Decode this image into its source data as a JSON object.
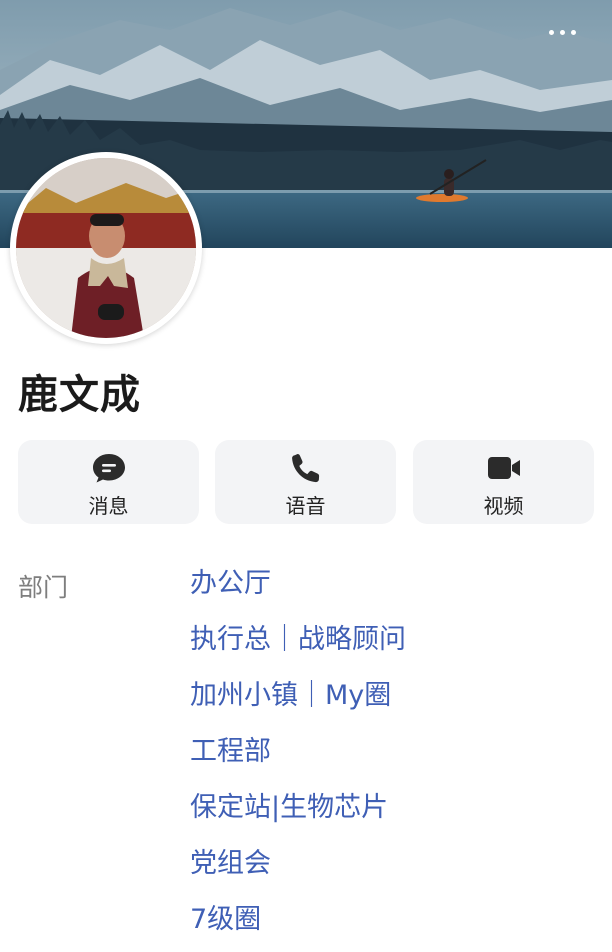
{
  "profile": {
    "name": "鹿文成"
  },
  "actions": [
    {
      "label": "消息",
      "icon": "message-icon"
    },
    {
      "label": "语音",
      "icon": "phone-icon"
    },
    {
      "label": "视频",
      "icon": "video-icon"
    }
  ],
  "department": {
    "label": "部门",
    "items": [
      "办公厅",
      "执行总｜战略顾问",
      "加州小镇｜My圈",
      "工程部",
      "保定站|生物芯片",
      "党组会",
      "7级圈"
    ]
  },
  "colors": {
    "link": "#3f5fb5",
    "label": "#7e7e7e",
    "button_bg": "#f3f4f6",
    "icon": "#2b2b2b"
  }
}
